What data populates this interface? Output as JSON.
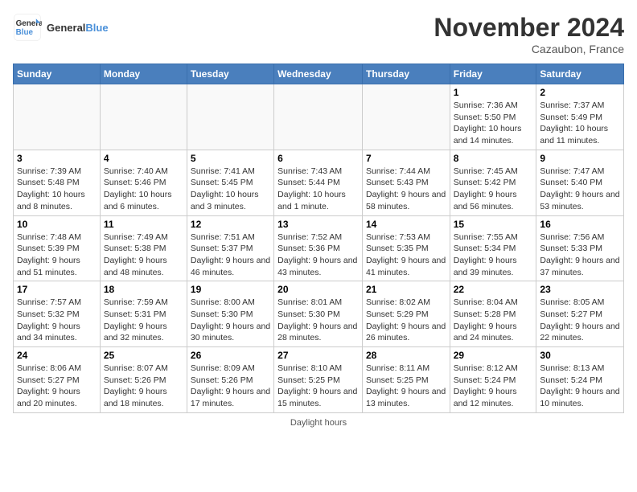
{
  "logo": {
    "line1": "General",
    "line2": "Blue"
  },
  "title": "November 2024",
  "location": "Cazaubon, France",
  "days_header": [
    "Sunday",
    "Monday",
    "Tuesday",
    "Wednesday",
    "Thursday",
    "Friday",
    "Saturday"
  ],
  "daylight_note": "Daylight hours",
  "weeks": [
    [
      {
        "day": "",
        "info": ""
      },
      {
        "day": "",
        "info": ""
      },
      {
        "day": "",
        "info": ""
      },
      {
        "day": "",
        "info": ""
      },
      {
        "day": "",
        "info": ""
      },
      {
        "day": "1",
        "info": "Sunrise: 7:36 AM\nSunset: 5:50 PM\nDaylight: 10 hours and 14 minutes."
      },
      {
        "day": "2",
        "info": "Sunrise: 7:37 AM\nSunset: 5:49 PM\nDaylight: 10 hours and 11 minutes."
      }
    ],
    [
      {
        "day": "3",
        "info": "Sunrise: 7:39 AM\nSunset: 5:48 PM\nDaylight: 10 hours and 8 minutes."
      },
      {
        "day": "4",
        "info": "Sunrise: 7:40 AM\nSunset: 5:46 PM\nDaylight: 10 hours and 6 minutes."
      },
      {
        "day": "5",
        "info": "Sunrise: 7:41 AM\nSunset: 5:45 PM\nDaylight: 10 hours and 3 minutes."
      },
      {
        "day": "6",
        "info": "Sunrise: 7:43 AM\nSunset: 5:44 PM\nDaylight: 10 hours and 1 minute."
      },
      {
        "day": "7",
        "info": "Sunrise: 7:44 AM\nSunset: 5:43 PM\nDaylight: 9 hours and 58 minutes."
      },
      {
        "day": "8",
        "info": "Sunrise: 7:45 AM\nSunset: 5:42 PM\nDaylight: 9 hours and 56 minutes."
      },
      {
        "day": "9",
        "info": "Sunrise: 7:47 AM\nSunset: 5:40 PM\nDaylight: 9 hours and 53 minutes."
      }
    ],
    [
      {
        "day": "10",
        "info": "Sunrise: 7:48 AM\nSunset: 5:39 PM\nDaylight: 9 hours and 51 minutes."
      },
      {
        "day": "11",
        "info": "Sunrise: 7:49 AM\nSunset: 5:38 PM\nDaylight: 9 hours and 48 minutes."
      },
      {
        "day": "12",
        "info": "Sunrise: 7:51 AM\nSunset: 5:37 PM\nDaylight: 9 hours and 46 minutes."
      },
      {
        "day": "13",
        "info": "Sunrise: 7:52 AM\nSunset: 5:36 PM\nDaylight: 9 hours and 43 minutes."
      },
      {
        "day": "14",
        "info": "Sunrise: 7:53 AM\nSunset: 5:35 PM\nDaylight: 9 hours and 41 minutes."
      },
      {
        "day": "15",
        "info": "Sunrise: 7:55 AM\nSunset: 5:34 PM\nDaylight: 9 hours and 39 minutes."
      },
      {
        "day": "16",
        "info": "Sunrise: 7:56 AM\nSunset: 5:33 PM\nDaylight: 9 hours and 37 minutes."
      }
    ],
    [
      {
        "day": "17",
        "info": "Sunrise: 7:57 AM\nSunset: 5:32 PM\nDaylight: 9 hours and 34 minutes."
      },
      {
        "day": "18",
        "info": "Sunrise: 7:59 AM\nSunset: 5:31 PM\nDaylight: 9 hours and 32 minutes."
      },
      {
        "day": "19",
        "info": "Sunrise: 8:00 AM\nSunset: 5:30 PM\nDaylight: 9 hours and 30 minutes."
      },
      {
        "day": "20",
        "info": "Sunrise: 8:01 AM\nSunset: 5:30 PM\nDaylight: 9 hours and 28 minutes."
      },
      {
        "day": "21",
        "info": "Sunrise: 8:02 AM\nSunset: 5:29 PM\nDaylight: 9 hours and 26 minutes."
      },
      {
        "day": "22",
        "info": "Sunrise: 8:04 AM\nSunset: 5:28 PM\nDaylight: 9 hours and 24 minutes."
      },
      {
        "day": "23",
        "info": "Sunrise: 8:05 AM\nSunset: 5:27 PM\nDaylight: 9 hours and 22 minutes."
      }
    ],
    [
      {
        "day": "24",
        "info": "Sunrise: 8:06 AM\nSunset: 5:27 PM\nDaylight: 9 hours and 20 minutes."
      },
      {
        "day": "25",
        "info": "Sunrise: 8:07 AM\nSunset: 5:26 PM\nDaylight: 9 hours and 18 minutes."
      },
      {
        "day": "26",
        "info": "Sunrise: 8:09 AM\nSunset: 5:26 PM\nDaylight: 9 hours and 17 minutes."
      },
      {
        "day": "27",
        "info": "Sunrise: 8:10 AM\nSunset: 5:25 PM\nDaylight: 9 hours and 15 minutes."
      },
      {
        "day": "28",
        "info": "Sunrise: 8:11 AM\nSunset: 5:25 PM\nDaylight: 9 hours and 13 minutes."
      },
      {
        "day": "29",
        "info": "Sunrise: 8:12 AM\nSunset: 5:24 PM\nDaylight: 9 hours and 12 minutes."
      },
      {
        "day": "30",
        "info": "Sunrise: 8:13 AM\nSunset: 5:24 PM\nDaylight: 9 hours and 10 minutes."
      }
    ]
  ]
}
